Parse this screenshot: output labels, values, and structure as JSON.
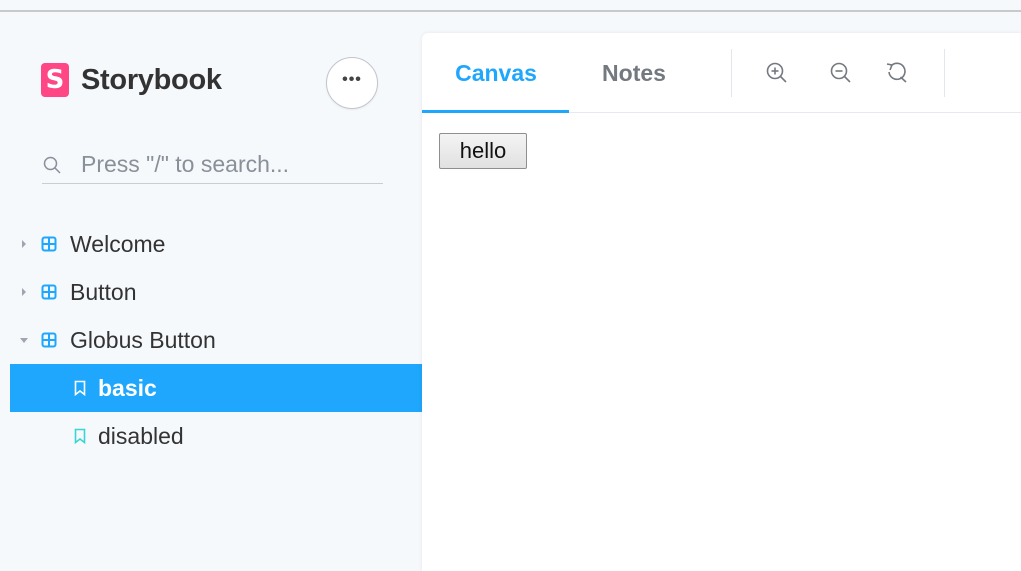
{
  "app": {
    "name": "Storybook",
    "logo_letter": "S",
    "brand_color": "#ff4785",
    "accent_color": "#1ea7fd"
  },
  "sidebar": {
    "menu_button_label": "•••",
    "search": {
      "placeholder": "Press \"/\" to search...",
      "value": ""
    },
    "tree": [
      {
        "label": "Welcome",
        "type": "component",
        "expanded": false
      },
      {
        "label": "Button",
        "type": "component",
        "expanded": false
      },
      {
        "label": "Globus Button",
        "type": "component",
        "expanded": true
      },
      {
        "label": "basic",
        "type": "story",
        "selected": true
      },
      {
        "label": "disabled",
        "type": "story",
        "selected": false
      }
    ]
  },
  "toolbar": {
    "tabs": [
      {
        "label": "Canvas",
        "active": true
      },
      {
        "label": "Notes",
        "active": false
      }
    ],
    "tools": [
      "zoom-in-icon",
      "zoom-out-icon",
      "reset-zoom-icon"
    ]
  },
  "preview": {
    "button_label": "hello"
  }
}
